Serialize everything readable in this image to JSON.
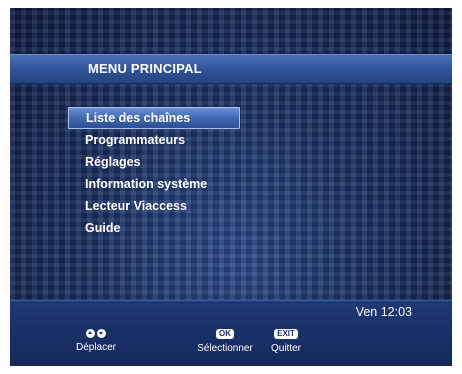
{
  "header": {
    "title": "MENU PRINCIPAL"
  },
  "menu": {
    "items": [
      {
        "label": "Liste des chaînes",
        "selected": true
      },
      {
        "label": "Programmateurs",
        "selected": false
      },
      {
        "label": "Réglages",
        "selected": false
      },
      {
        "label": "Information système",
        "selected": false
      },
      {
        "label": "Lecteur Viaccess",
        "selected": false
      },
      {
        "label": "Guide",
        "selected": false
      }
    ]
  },
  "status": {
    "clock": "Ven 12:03"
  },
  "hints": {
    "move": {
      "label": "Déplacer",
      "icon": "up-down-arrows-icon"
    },
    "select": {
      "key": "OK",
      "label": "Sélectionner"
    },
    "quit": {
      "key": "EXIT",
      "label": "Quitter"
    }
  },
  "colors": {
    "accent": "#3f67b1",
    "background": "#1d3468",
    "text": "#ffffff"
  }
}
